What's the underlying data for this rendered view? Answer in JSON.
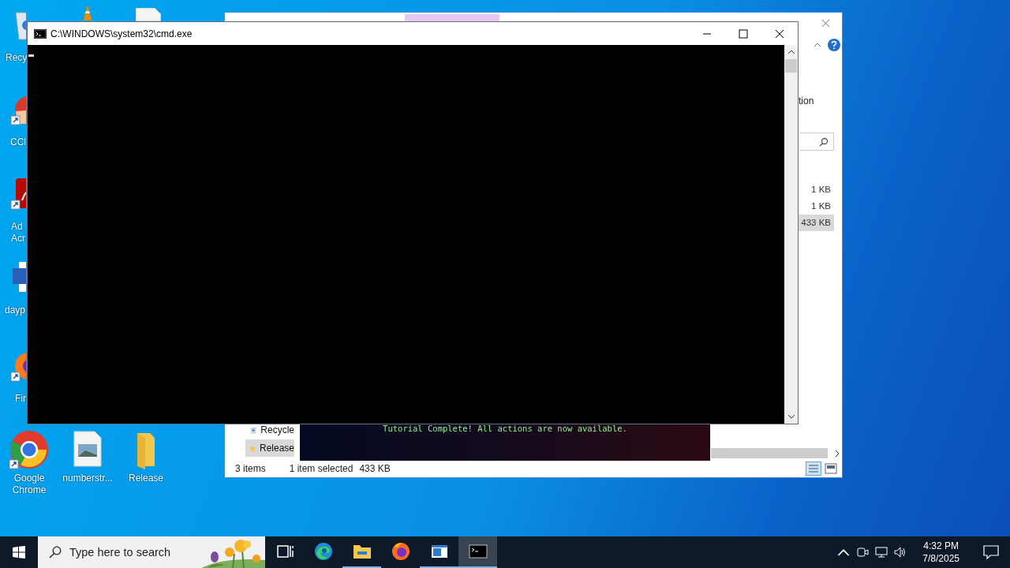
{
  "desktop_icons": [
    {
      "kind": "recycle",
      "lines": [
        "Recy"
      ],
      "shortcut": false
    },
    {
      "kind": "ccleaner",
      "lines": [
        "CCl"
      ],
      "shortcut": true
    },
    {
      "kind": "acrobat",
      "lines": [
        "Ad",
        "Acr"
      ],
      "shortcut": true
    },
    {
      "kind": "word",
      "lines": [
        "dayp"
      ],
      "shortcut": false
    },
    {
      "kind": "firefox",
      "lines": [
        "Fir"
      ],
      "shortcut": true
    }
  ],
  "desktop_bottom_icons": [
    {
      "kind": "chrome",
      "label": "Google Chrome",
      "shortcut": true
    },
    {
      "kind": "image-file",
      "label": "numberstr...",
      "shortcut": false
    },
    {
      "kind": "folder",
      "label": "Release",
      "shortcut": false
    }
  ],
  "cmd_window": {
    "title": "C:\\WINDOWS\\system32\\cmd.exe"
  },
  "explorer": {
    "ribbon_text": "tion",
    "sizes": [
      {
        "size": "1 KB",
        "selected": false
      },
      {
        "size": "1 KB",
        "selected": false
      },
      {
        "size": "433 KB",
        "selected": true
      }
    ],
    "nav_items": [
      {
        "kind": "recycle",
        "label": "Recycle",
        "selected": false
      },
      {
        "kind": "folder",
        "label": "Release",
        "selected": true
      }
    ],
    "status": {
      "count": "3 items",
      "selection": "1 item selected",
      "size": "433 KB"
    }
  },
  "overlay": {
    "message": "Tutorial Complete! All actions are now available."
  },
  "taskbar": {
    "search_placeholder": "Type here to search",
    "apps": [
      {
        "kind": "taskview",
        "running": false,
        "selected": false
      },
      {
        "kind": "edge",
        "running": false,
        "selected": false
      },
      {
        "kind": "explorer",
        "running": true,
        "selected": false
      },
      {
        "kind": "firefox",
        "running": false,
        "selected": false
      },
      {
        "kind": "app-window",
        "running": true,
        "selected": false
      },
      {
        "kind": "cmd",
        "running": true,
        "selected": true
      }
    ],
    "time": "4:32 PM",
    "date": "7/8/2025"
  }
}
